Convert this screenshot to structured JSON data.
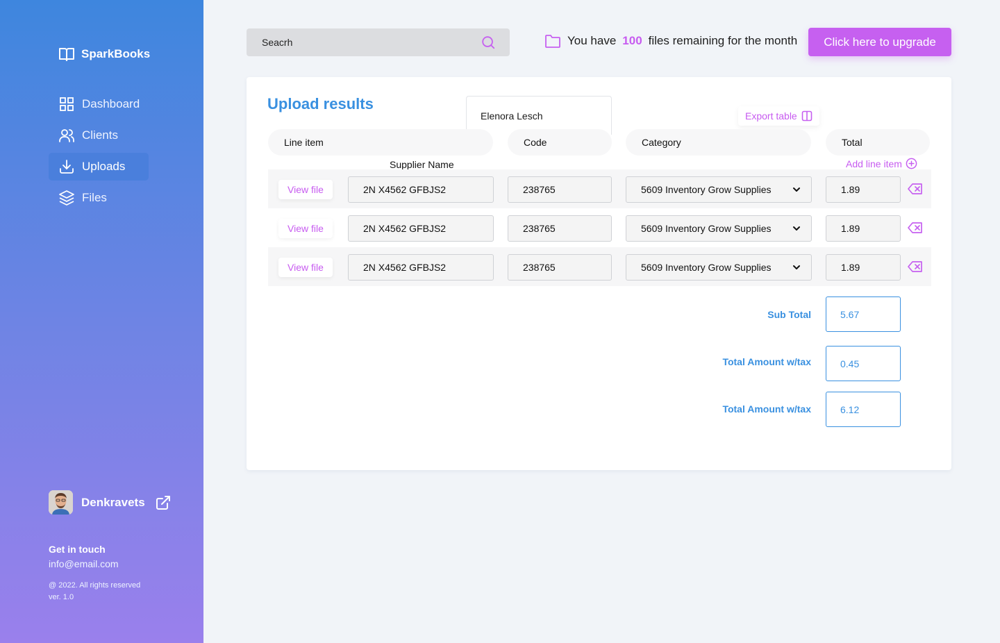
{
  "brand": {
    "name": "SparkBooks"
  },
  "nav": [
    {
      "label": "Dashboard",
      "icon": "grid-icon",
      "active": false
    },
    {
      "label": "Clients",
      "icon": "users-icon",
      "active": false
    },
    {
      "label": "Uploads",
      "icon": "download-icon",
      "active": true
    },
    {
      "label": "Files",
      "icon": "layers-icon",
      "active": false
    }
  ],
  "user": {
    "name": "Denkravets"
  },
  "footer": {
    "get_in_touch": "Get in touch",
    "email": "info@email.com",
    "copyright": "@ 2022. All rights reserved",
    "version": "ver. 1.0"
  },
  "search": {
    "placeholder": "Seacrh"
  },
  "files_notice": {
    "prefix": "You have",
    "count": "100",
    "suffix": "files remaining for the month"
  },
  "upgrade_label": "Click here to upgrade",
  "card": {
    "title": "Upload results",
    "supplier_name_value": "Elenora Lesch",
    "export_label": "Export table",
    "add_line_label": "Add line item",
    "supplier_label": "Supplier Name",
    "headers": {
      "line_item": "Line item",
      "code": "Code",
      "category": "Category",
      "total": "Total"
    },
    "rows": [
      {
        "view_label": "View file",
        "line_item": "2N X4562 GFBJS2",
        "code": "238765",
        "category": "5609 Inventory Grow Supplies",
        "total": "1.89"
      },
      {
        "view_label": "View file",
        "line_item": "2N X4562 GFBJS2",
        "code": "238765",
        "category": "5609 Inventory Grow Supplies",
        "total": "1.89"
      },
      {
        "view_label": "View file",
        "line_item": "2N X4562 GFBJS2",
        "code": "238765",
        "category": "5609 Inventory Grow Supplies",
        "total": "1.89"
      }
    ],
    "summary": [
      {
        "label": "Sub Total",
        "value": "5.67"
      },
      {
        "label": "Total Amount w/tax",
        "value": "0.45"
      },
      {
        "label": "Total Amount w/tax",
        "value": "6.12"
      }
    ]
  },
  "colors": {
    "accent_purple": "#C660F0",
    "accent_blue": "#3990E0",
    "sidebar_top": "#3E86DE",
    "sidebar_bottom": "#9A80EC"
  }
}
